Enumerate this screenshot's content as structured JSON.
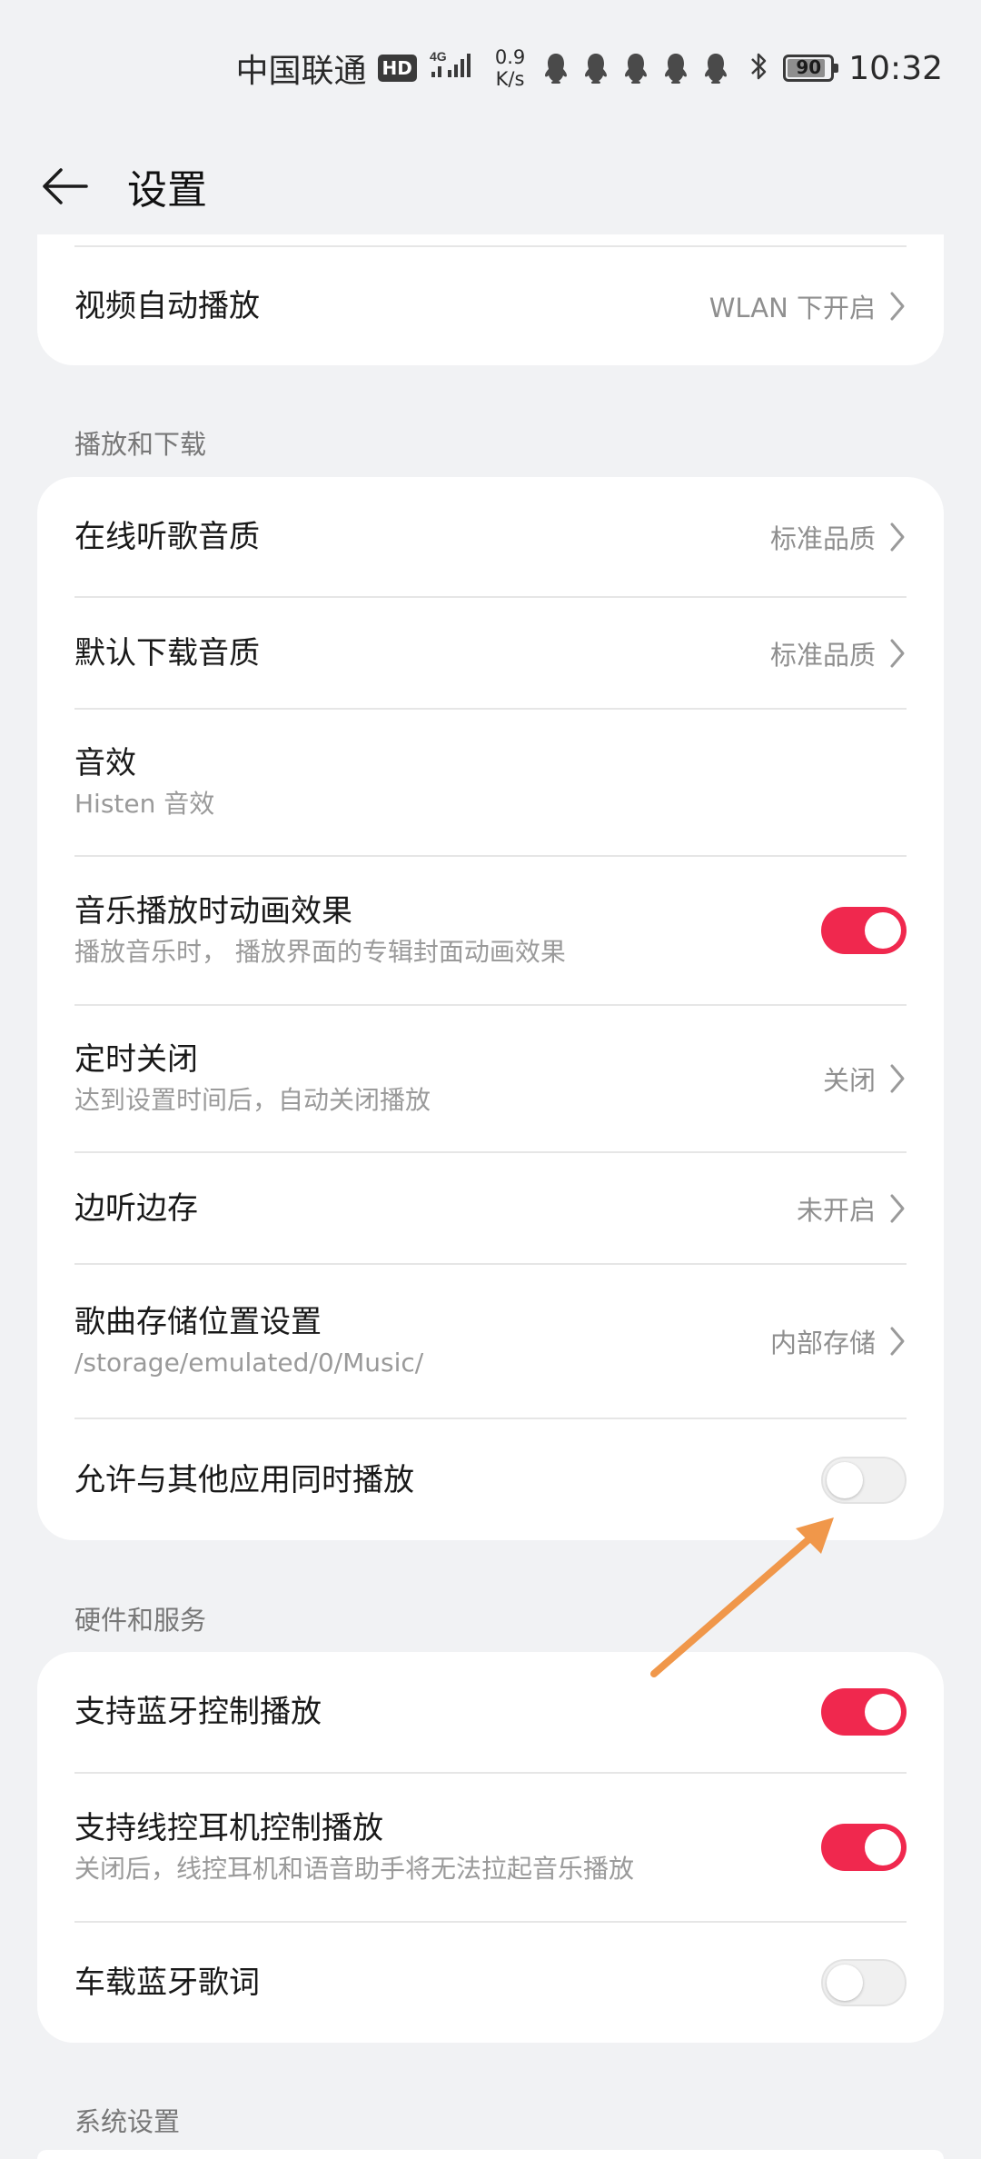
{
  "status_bar": {
    "carrier": "中国联通",
    "hd": "HD",
    "network": "4G",
    "speed_value": "0.9",
    "speed_unit": "K/s",
    "battery": "90",
    "battery_level": 0.9,
    "time": "10:32",
    "icons": [
      "qq-icon",
      "qq-icon",
      "qq-icon",
      "qq-icon",
      "qq-icon",
      "bluetooth-icon"
    ]
  },
  "header": {
    "back_icon": "arrow-left-icon",
    "title": "设置"
  },
  "top_card": {
    "video_autoplay": {
      "label": "视频自动播放",
      "value": "WLAN 下开启"
    }
  },
  "section_playback": {
    "title": "播放和下载",
    "items": [
      {
        "label": "在线听歌音质",
        "value": "标准品质"
      },
      {
        "label": "默认下载音质",
        "value": "标准品质"
      },
      {
        "label": "音效",
        "sub": "Histen 音效"
      },
      {
        "label": "音乐播放时动画效果",
        "sub": "播放音乐时， 播放界面的专辑封面动画效果",
        "toggle": true
      },
      {
        "label": "定时关闭",
        "sub": "达到设置时间后，自动关闭播放",
        "value": "关闭"
      },
      {
        "label": "边听边存",
        "value": "未开启"
      },
      {
        "label": "歌曲存储位置设置",
        "sub": "/storage/emulated/0/Music/",
        "value": "内部存储"
      },
      {
        "label": "允许与其他应用同时播放",
        "toggle": false
      }
    ]
  },
  "section_hardware": {
    "title": "硬件和服务",
    "items": [
      {
        "label": "支持蓝牙控制播放",
        "toggle": true
      },
      {
        "label": "支持线控耳机控制播放",
        "sub": "关闭后，线控耳机和语音助手将无法拉起音乐播放",
        "toggle": true
      },
      {
        "label": "车载蓝牙歌词",
        "toggle": false
      }
    ]
  },
  "section_system": {
    "title": "系统设置"
  },
  "colors": {
    "background": "#F1F2F4",
    "card": "#FFFFFF",
    "toggle_on": "#F0284E",
    "toggle_off": "#F0F0F0",
    "annotation_arrow": "#F0974A"
  }
}
